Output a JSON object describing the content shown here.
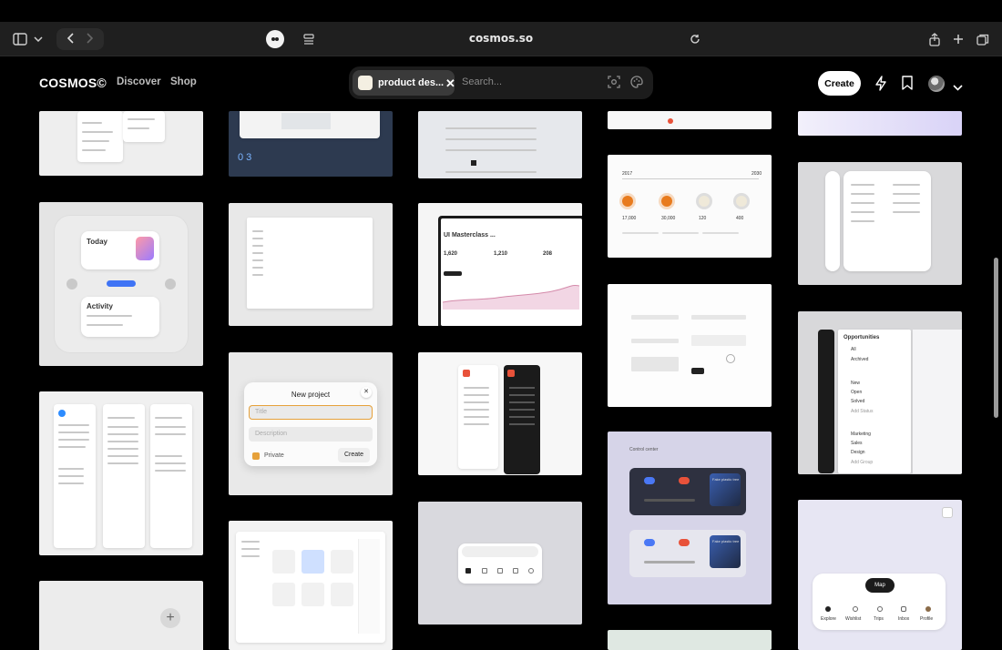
{
  "browser": {
    "url": "cosmos.so",
    "icons": [
      "sidebar-icon",
      "chevron-down-icon",
      "back-icon",
      "forward-icon",
      "extension-icon",
      "reader-icon",
      "reload-icon",
      "share-icon",
      "new-tab-icon",
      "tabs-icon"
    ]
  },
  "header": {
    "logo": "COSMOS©",
    "nav": [
      "Discover",
      "Shop"
    ],
    "search": {
      "chip_label": "product des...",
      "placeholder": "Search...",
      "icons": [
        "visual-search-icon",
        "color-palette-icon"
      ]
    },
    "create_label": "Create",
    "icons": [
      "lightning-icon",
      "bookmark-icon",
      "avatar",
      "chevron-down-icon"
    ]
  },
  "cards": {
    "new_project": {
      "title": "New project",
      "title_placeholder": "Title",
      "description_placeholder": "Description",
      "private_label": "Private",
      "create_label": "Create"
    },
    "masterclass": {
      "title": "UI Masterclass ...",
      "stats": [
        "1,620",
        "1,210",
        "208"
      ]
    },
    "finance": {
      "year_left": "2017",
      "year_right": "2030",
      "values": [
        "17,000",
        "30,000",
        "120",
        "400"
      ]
    },
    "activity": {
      "today_label": "Today",
      "activity_label": "Activity"
    },
    "control_center": {
      "title": "Control center",
      "tracks": [
        "Fake plastic tree",
        "Fake plastic tree"
      ]
    },
    "opportunities": {
      "title": "Opportunities",
      "items": [
        "All",
        "Archived",
        "New",
        "Open",
        "Solved",
        "Add Status",
        "Marketing",
        "Sales",
        "Design",
        "Add Group"
      ]
    },
    "map_nav": {
      "map_button": "Map",
      "tabs": [
        "Explore",
        "Wishlist",
        "Trips",
        "Inbox",
        "Profile"
      ]
    }
  },
  "colors": {
    "background": "#000000",
    "browser_bar": "#1f1f1f",
    "search_bg": "#1c1c1c",
    "accent_orange": "#e6a13a",
    "accent_blue": "#3f74f5"
  }
}
